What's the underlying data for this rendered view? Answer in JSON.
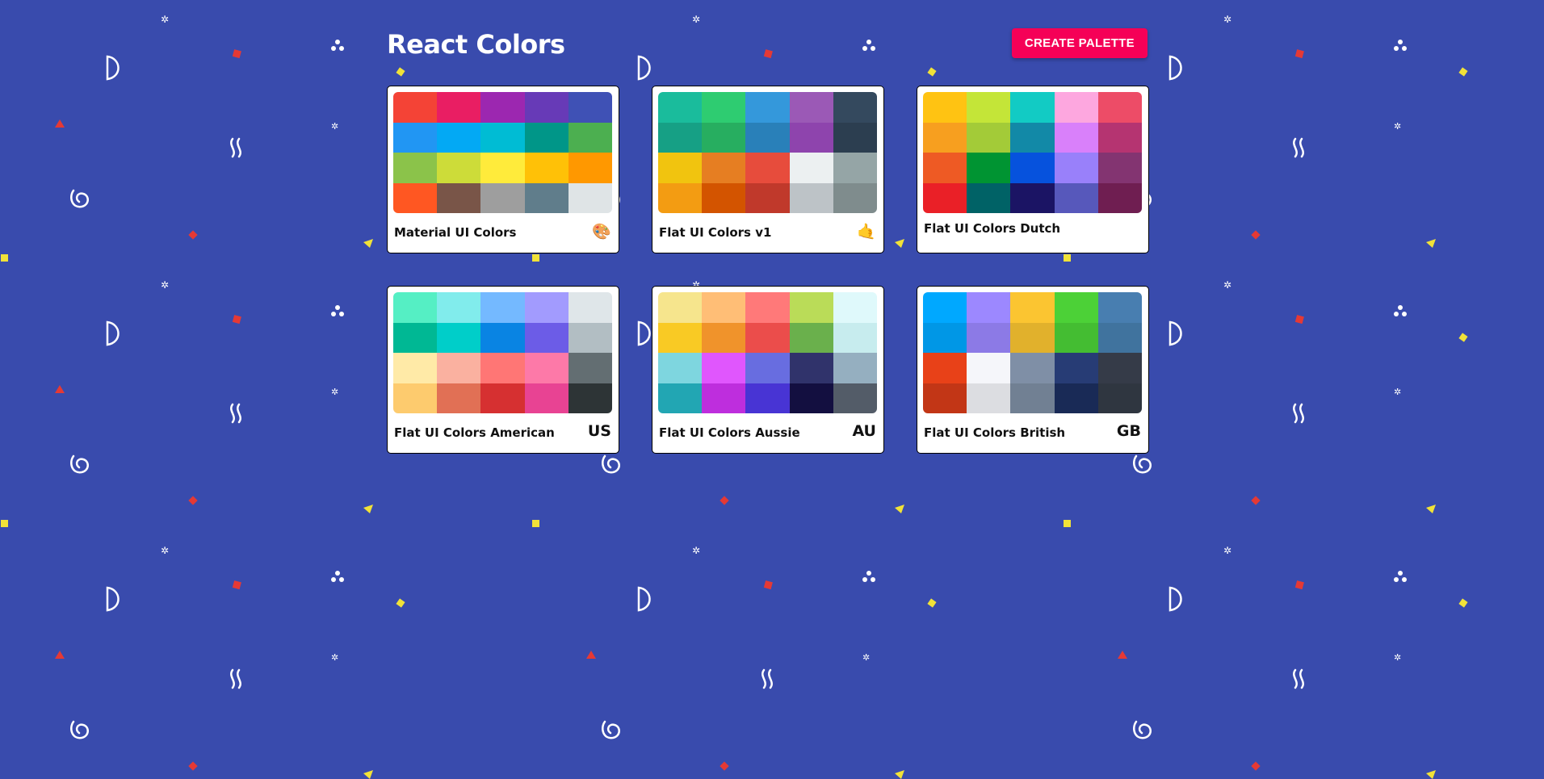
{
  "header": {
    "title": "React Colors",
    "create_button_label": "CREATE PALETTE"
  },
  "palettes": [
    {
      "name": "Material UI Colors",
      "emoji": "🎨",
      "colors": [
        "#f44336",
        "#e91e63",
        "#9c27b0",
        "#673ab7",
        "#3f51b5",
        "#2196f3",
        "#03a9f4",
        "#00bcd4",
        "#009688",
        "#4caf50",
        "#8bc34a",
        "#cddc39",
        "#ffeb3b",
        "#ffc107",
        "#ff9800",
        "#ff5722",
        "#795548",
        "#9e9e9e",
        "#607d8b",
        "#dfe4e6"
      ]
    },
    {
      "name": "Flat UI Colors v1",
      "emoji": "🤙",
      "colors": [
        "#1abc9c",
        "#2ecc71",
        "#3498db",
        "#9b59b6",
        "#34495e",
        "#16a085",
        "#27ae60",
        "#2980b9",
        "#8e44ad",
        "#2c3e50",
        "#f1c40f",
        "#e67e22",
        "#e74c3c",
        "#ecf0f1",
        "#95a5a6",
        "#f39c12",
        "#d35400",
        "#c0392b",
        "#bdc3c7",
        "#7f8c8d"
      ]
    },
    {
      "name": "Flat UI Colors Dutch",
      "emoji": "",
      "colors": [
        "#ffc312",
        "#c4e538",
        "#12cbc4",
        "#fda7df",
        "#ed4c67",
        "#f79f1f",
        "#a3cb38",
        "#1289a7",
        "#d980fa",
        "#b53471",
        "#ee5a24",
        "#009432",
        "#0652dd",
        "#9980fa",
        "#833471",
        "#ea2027",
        "#006266",
        "#1b1464",
        "#5758bb",
        "#6f1e51"
      ]
    },
    {
      "name": "Flat UI Colors American",
      "emoji": "US",
      "colors": [
        "#55efc4",
        "#81ecec",
        "#74b9ff",
        "#a29bfe",
        "#dfe6e9",
        "#00b894",
        "#00cec9",
        "#0984e3",
        "#6c5ce7",
        "#b2bec3",
        "#ffeaa7",
        "#fab1a0",
        "#ff7675",
        "#fd79a8",
        "#636e72",
        "#fdcb6e",
        "#e17055",
        "#d63031",
        "#e84393",
        "#2d3436"
      ]
    },
    {
      "name": "Flat UI Colors Aussie",
      "emoji": "AU",
      "colors": [
        "#f6e58d",
        "#ffbe76",
        "#ff7979",
        "#badc58",
        "#dff9fb",
        "#f9ca24",
        "#f0932b",
        "#eb4d4b",
        "#6ab04c",
        "#c7ecee",
        "#7ed6df",
        "#e056fd",
        "#686de0",
        "#30336b",
        "#95afc0",
        "#22a6b3",
        "#be2edd",
        "#4834d4",
        "#130f40",
        "#535c68"
      ]
    },
    {
      "name": "Flat UI Colors British",
      "emoji": "GB",
      "colors": [
        "#00a8ff",
        "#9c88ff",
        "#fbc531",
        "#4cd137",
        "#487eb0",
        "#0097e6",
        "#8c7ae6",
        "#e1b12c",
        "#44bd32",
        "#40739e",
        "#e84118",
        "#f5f6fa",
        "#7f8fa6",
        "#273c75",
        "#353b48",
        "#c23616",
        "#dcdde1",
        "#718093",
        "#192a56",
        "#2f3640"
      ]
    }
  ]
}
